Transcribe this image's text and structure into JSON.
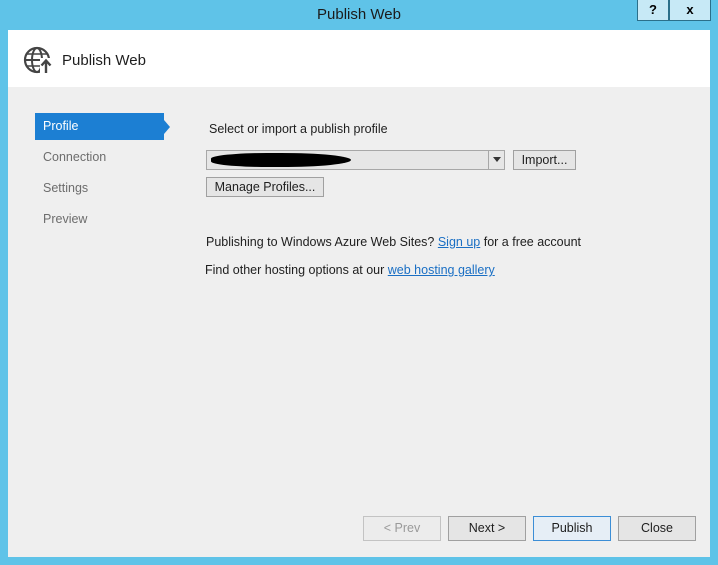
{
  "window": {
    "title": "Publish Web",
    "help_label": "?",
    "close_label": "x"
  },
  "header": {
    "title": "Publish Web",
    "icon": "globe-publish-icon"
  },
  "nav": {
    "items": [
      {
        "label": "Profile",
        "active": true
      },
      {
        "label": "Connection",
        "active": false
      },
      {
        "label": "Settings",
        "active": false
      },
      {
        "label": "Preview",
        "active": false
      }
    ]
  },
  "profile": {
    "select_label": "Select or import a publish profile",
    "import_label": "Import...",
    "manage_label": "Manage Profiles...",
    "azure_text_before": "Publishing to Windows Azure Web Sites?",
    "azure_link": "Sign up",
    "azure_text_after": "for a free account",
    "hosting_text_before": "Find other hosting options at our",
    "hosting_link": "web hosting gallery"
  },
  "footer": {
    "prev_label": "< Prev",
    "next_label": "Next >",
    "publish_label": "Publish",
    "close_label": "Close"
  },
  "colors": {
    "frame": "#5fc3e8",
    "accent": "#1c7fd3",
    "link": "#1a6fc4"
  }
}
